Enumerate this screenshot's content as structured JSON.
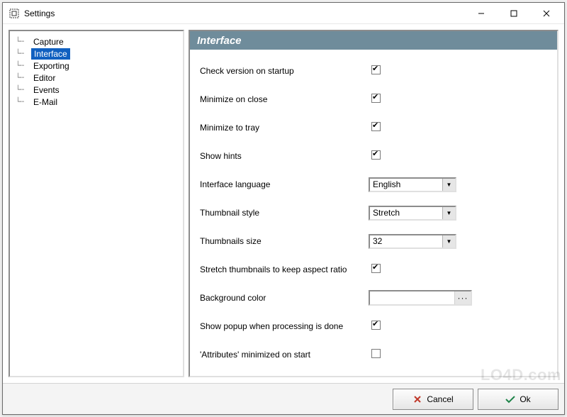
{
  "window": {
    "title": "Settings"
  },
  "sidebar": {
    "items": [
      {
        "label": "Capture"
      },
      {
        "label": "Interface"
      },
      {
        "label": "Exporting"
      },
      {
        "label": "Editor"
      },
      {
        "label": "Events"
      },
      {
        "label": "E-Mail"
      }
    ],
    "selected_index": 1
  },
  "main": {
    "header": "Interface",
    "rows": [
      {
        "label": "Check version on startup",
        "type": "checkbox",
        "checked": true
      },
      {
        "label": "Minimize on close",
        "type": "checkbox",
        "checked": true
      },
      {
        "label": "Minimize to tray",
        "type": "checkbox",
        "checked": true
      },
      {
        "label": "Show hints",
        "type": "checkbox",
        "checked": true
      },
      {
        "label": "Interface language",
        "type": "combo",
        "value": "English"
      },
      {
        "label": "Thumbnail style",
        "type": "combo",
        "value": "Stretch"
      },
      {
        "label": "Thumbnails size",
        "type": "combo",
        "value": "32"
      },
      {
        "label": "Stretch thumbnails to keep aspect ratio",
        "type": "checkbox",
        "checked": true
      },
      {
        "label": "Background color",
        "type": "color",
        "value": "#ffffff"
      },
      {
        "label": "Show popup when processing is done",
        "type": "checkbox",
        "checked": true
      },
      {
        "label": "'Attributes' minimized on start",
        "type": "checkbox",
        "checked": false
      }
    ]
  },
  "footer": {
    "cancel": "Cancel",
    "ok": "Ok"
  },
  "watermark": "LO4D.com"
}
